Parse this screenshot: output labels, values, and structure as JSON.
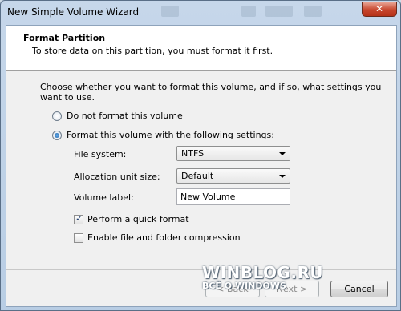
{
  "window": {
    "title": "New Simple Volume Wizard",
    "close_glyph": "✕"
  },
  "header": {
    "title": "Format Partition",
    "subtitle": "To store data on this partition, you must format it first."
  },
  "intro_text": "Choose whether you want to format this volume, and if so, what settings you want to use.",
  "options": {
    "no_format": {
      "label": "Do not format this volume",
      "selected": false
    },
    "format": {
      "label": "Format this volume with the following settings:",
      "selected": true
    }
  },
  "settings": {
    "file_system": {
      "label": "File system:",
      "value": "NTFS"
    },
    "allocation": {
      "label": "Allocation unit size:",
      "value": "Default"
    },
    "volume_label": {
      "label": "Volume label:",
      "value": "New Volume"
    }
  },
  "checkboxes": {
    "quick_format": {
      "label": "Perform a quick format",
      "checked": true
    },
    "compression": {
      "label": "Enable file and folder compression",
      "checked": false
    }
  },
  "buttons": {
    "back": "< Back",
    "next": "Next >",
    "cancel": "Cancel"
  },
  "watermark": {
    "line1": "WINBLOG.RU",
    "line2": "ВСЁ О WINDOWS"
  }
}
